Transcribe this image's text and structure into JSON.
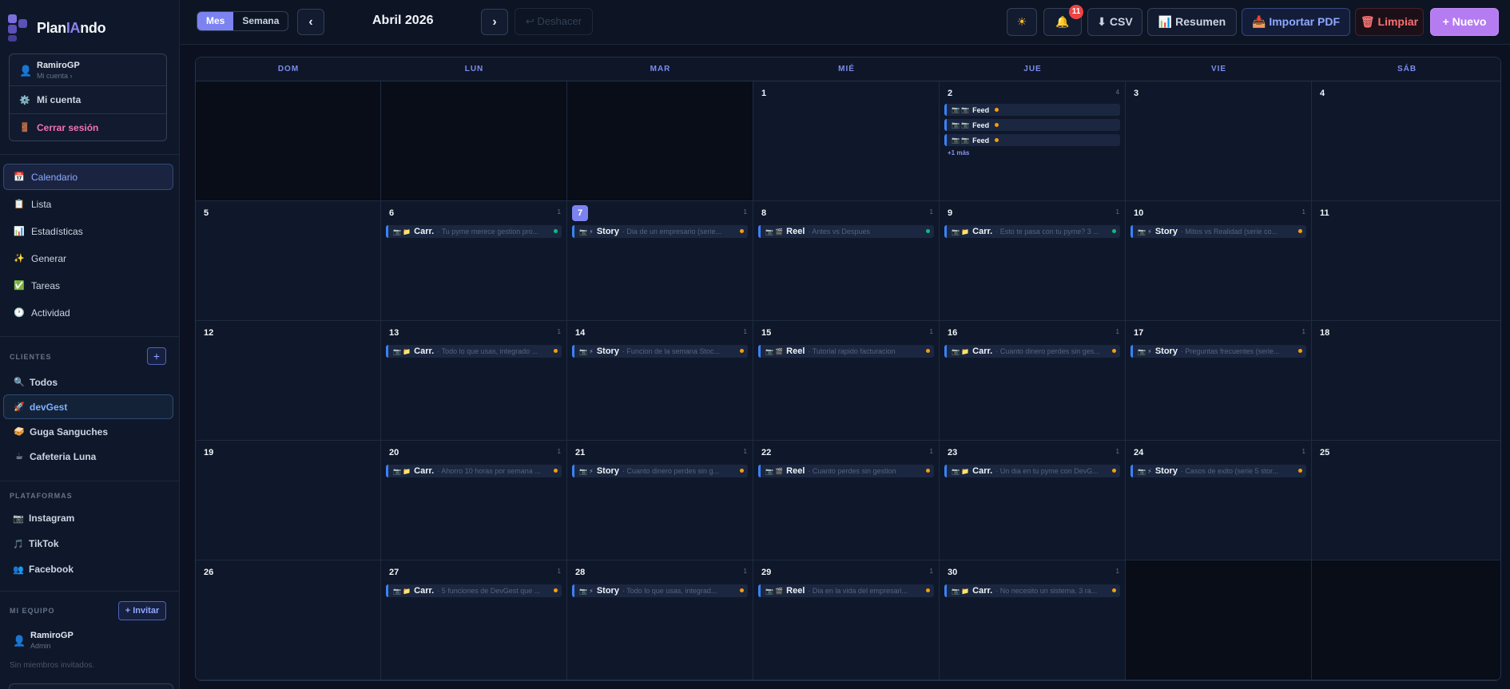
{
  "app": {
    "name_prefix": "Plan",
    "name_highlight": "IA",
    "name_suffix": "ndo"
  },
  "account": {
    "user": "RamiroGP",
    "sub": "Mi cuenta ›",
    "my_account": "Mi cuenta",
    "logout": "Cerrar sesión"
  },
  "nav": [
    {
      "label": "Calendario",
      "icon": "calendar-icon",
      "glyph": "📅",
      "active": true
    },
    {
      "label": "Lista",
      "icon": "clipboard-icon",
      "glyph": "📋",
      "active": false
    },
    {
      "label": "Estadísticas",
      "icon": "chart-icon",
      "glyph": "📊",
      "active": false
    },
    {
      "label": "Generar",
      "icon": "sparkles-icon",
      "glyph": "✨",
      "active": false
    },
    {
      "label": "Tareas",
      "icon": "check-icon",
      "glyph": "✅",
      "active": false
    },
    {
      "label": "Actividad",
      "icon": "clock-icon",
      "glyph": "🕐",
      "active": false
    }
  ],
  "clients": {
    "label": "CLIENTES",
    "add": "+",
    "items": [
      {
        "label": "Todos",
        "icon": "search-icon",
        "glyph": "🔍",
        "active": false
      },
      {
        "label": "devGest",
        "icon": "rocket-icon",
        "glyph": "🚀",
        "active": true
      },
      {
        "label": "Guga Sanguches",
        "icon": "sandwich-icon",
        "glyph": "🥪",
        "active": false
      },
      {
        "label": "Cafeteria Luna",
        "icon": "coffee-icon",
        "glyph": "☕",
        "active": false
      }
    ]
  },
  "platforms": {
    "label": "PLATAFORMAS",
    "items": [
      {
        "label": "Instagram",
        "icon": "camera-icon",
        "glyph": "📷"
      },
      {
        "label": "TikTok",
        "icon": "music-note-icon",
        "glyph": "🎵"
      },
      {
        "label": "Facebook",
        "icon": "people-icon",
        "glyph": "👥"
      }
    ]
  },
  "team": {
    "label": "MI EQUIPO",
    "invite": "+ Invitar",
    "member_name": "RamiroGP",
    "member_role": "Admin",
    "empty": "Sin miembros invitados."
  },
  "toolbar": {
    "view_month": "Mes",
    "view_week": "Semana",
    "prev": "‹",
    "next": "›",
    "month_title": "Abril 2026",
    "undo": "↩ Deshacer",
    "theme_glyph": "☀",
    "bell_glyph": "🔔",
    "notifications": "11",
    "csv": "⬇ CSV",
    "summary": "📊 Resumen",
    "import_pdf": "📥 Importar PDF",
    "clear": "🗑 Limpiar",
    "new": "+ Nuevo"
  },
  "calendar": {
    "weekdays": [
      "DOM",
      "LUN",
      "MAR",
      "MIÉ",
      "JUE",
      "VIE",
      "SÁB"
    ],
    "today": 7,
    "more_label": "+1 más",
    "days": [
      {
        "d": "",
        "n": ""
      },
      {
        "d": "",
        "n": ""
      },
      {
        "d": "",
        "n": ""
      },
      {
        "d": "1",
        "n": ""
      },
      {
        "d": "2",
        "n": "4",
        "events": [
          {
            "type": "Feed",
            "desc": "",
            "ic": "📷 📷",
            "dot": "amber",
            "feed": true
          },
          {
            "type": "Feed",
            "desc": "",
            "ic": "📷 📷",
            "dot": "amber",
            "feed": true
          },
          {
            "type": "Feed",
            "desc": "",
            "ic": "📷 📷",
            "dot": "amber",
            "feed": true
          }
        ],
        "more": true
      },
      {
        "d": "3",
        "n": ""
      },
      {
        "d": "4",
        "n": ""
      },
      {
        "d": "5",
        "n": ""
      },
      {
        "d": "6",
        "n": "1",
        "events": [
          {
            "type": "Carr.",
            "desc": "· Tu pyme merece gestion pro...",
            "ic": "📷 📁",
            "dot": "green"
          }
        ]
      },
      {
        "d": "7",
        "n": "1",
        "events": [
          {
            "type": "Story",
            "desc": "· Dia de un empresario (serie...",
            "ic": "📷 ⚡",
            "dot": "amber"
          }
        ]
      },
      {
        "d": "8",
        "n": "1",
        "events": [
          {
            "type": "Reel",
            "desc": "· Antes vs Despues",
            "ic": "📷 🎬",
            "dot": "green"
          }
        ]
      },
      {
        "d": "9",
        "n": "1",
        "events": [
          {
            "type": "Carr.",
            "desc": "· Esto te pasa con tu pyme? 3 ...",
            "ic": "📷 📁",
            "dot": "green"
          }
        ]
      },
      {
        "d": "10",
        "n": "1",
        "events": [
          {
            "type": "Story",
            "desc": "· Mitos vs Realidad (serie co...",
            "ic": "📷 ⚡",
            "dot": "amber"
          }
        ]
      },
      {
        "d": "11",
        "n": ""
      },
      {
        "d": "12",
        "n": ""
      },
      {
        "d": "13",
        "n": "1",
        "events": [
          {
            "type": "Carr.",
            "desc": "· Todo lo que usas, integrado ...",
            "ic": "📷 📁",
            "dot": "amber"
          }
        ]
      },
      {
        "d": "14",
        "n": "1",
        "events": [
          {
            "type": "Story",
            "desc": "· Funcion de la semana Stoc...",
            "ic": "📷 ⚡",
            "dot": "amber"
          }
        ]
      },
      {
        "d": "15",
        "n": "1",
        "events": [
          {
            "type": "Reel",
            "desc": "· Tutorial rapido facturacion",
            "ic": "📷 🎬",
            "dot": "amber"
          }
        ]
      },
      {
        "d": "16",
        "n": "1",
        "events": [
          {
            "type": "Carr.",
            "desc": "· Cuanto dinero perdes sin ges...",
            "ic": "📷 📁",
            "dot": "amber"
          }
        ]
      },
      {
        "d": "17",
        "n": "1",
        "events": [
          {
            "type": "Story",
            "desc": "· Preguntas frecuentes (serie...",
            "ic": "📷 ⚡",
            "dot": "amber"
          }
        ]
      },
      {
        "d": "18",
        "n": ""
      },
      {
        "d": "19",
        "n": ""
      },
      {
        "d": "20",
        "n": "1",
        "events": [
          {
            "type": "Carr.",
            "desc": "· Ahorro 10 horas por semana ...",
            "ic": "📷 📁",
            "dot": "amber"
          }
        ]
      },
      {
        "d": "21",
        "n": "1",
        "events": [
          {
            "type": "Story",
            "desc": "· Cuanto dinero perdes sin g...",
            "ic": "📷 ⚡",
            "dot": "amber"
          }
        ]
      },
      {
        "d": "22",
        "n": "1",
        "events": [
          {
            "type": "Reel",
            "desc": "· Cuanto perdes sin gestion",
            "ic": "📷 🎬",
            "dot": "amber"
          }
        ]
      },
      {
        "d": "23",
        "n": "1",
        "events": [
          {
            "type": "Carr.",
            "desc": "· Un dia en tu pyme con DevG...",
            "ic": "📷 📁",
            "dot": "amber"
          }
        ]
      },
      {
        "d": "24",
        "n": "1",
        "events": [
          {
            "type": "Story",
            "desc": "· Casos de exito (serie 5 stor...",
            "ic": "📷 ⚡",
            "dot": "amber"
          }
        ]
      },
      {
        "d": "25",
        "n": ""
      },
      {
        "d": "26",
        "n": ""
      },
      {
        "d": "27",
        "n": "1",
        "events": [
          {
            "type": "Carr.",
            "desc": "· 5 funciones de DevGest que ...",
            "ic": "📷 📁",
            "dot": "amber"
          }
        ]
      },
      {
        "d": "28",
        "n": "1",
        "events": [
          {
            "type": "Story",
            "desc": "· Todo lo que usas, integrad...",
            "ic": "📷 ⚡",
            "dot": "amber"
          }
        ]
      },
      {
        "d": "29",
        "n": "1",
        "events": [
          {
            "type": "Reel",
            "desc": "· Dia en la vida del empresari...",
            "ic": "📷 🎬",
            "dot": "amber"
          }
        ]
      },
      {
        "d": "30",
        "n": "1",
        "events": [
          {
            "type": "Carr.",
            "desc": "· No necesito un sistema. 3 ra...",
            "ic": "📷 📁",
            "dot": "amber"
          }
        ]
      },
      {
        "d": "",
        "n": ""
      },
      {
        "d": "",
        "n": ""
      }
    ]
  }
}
